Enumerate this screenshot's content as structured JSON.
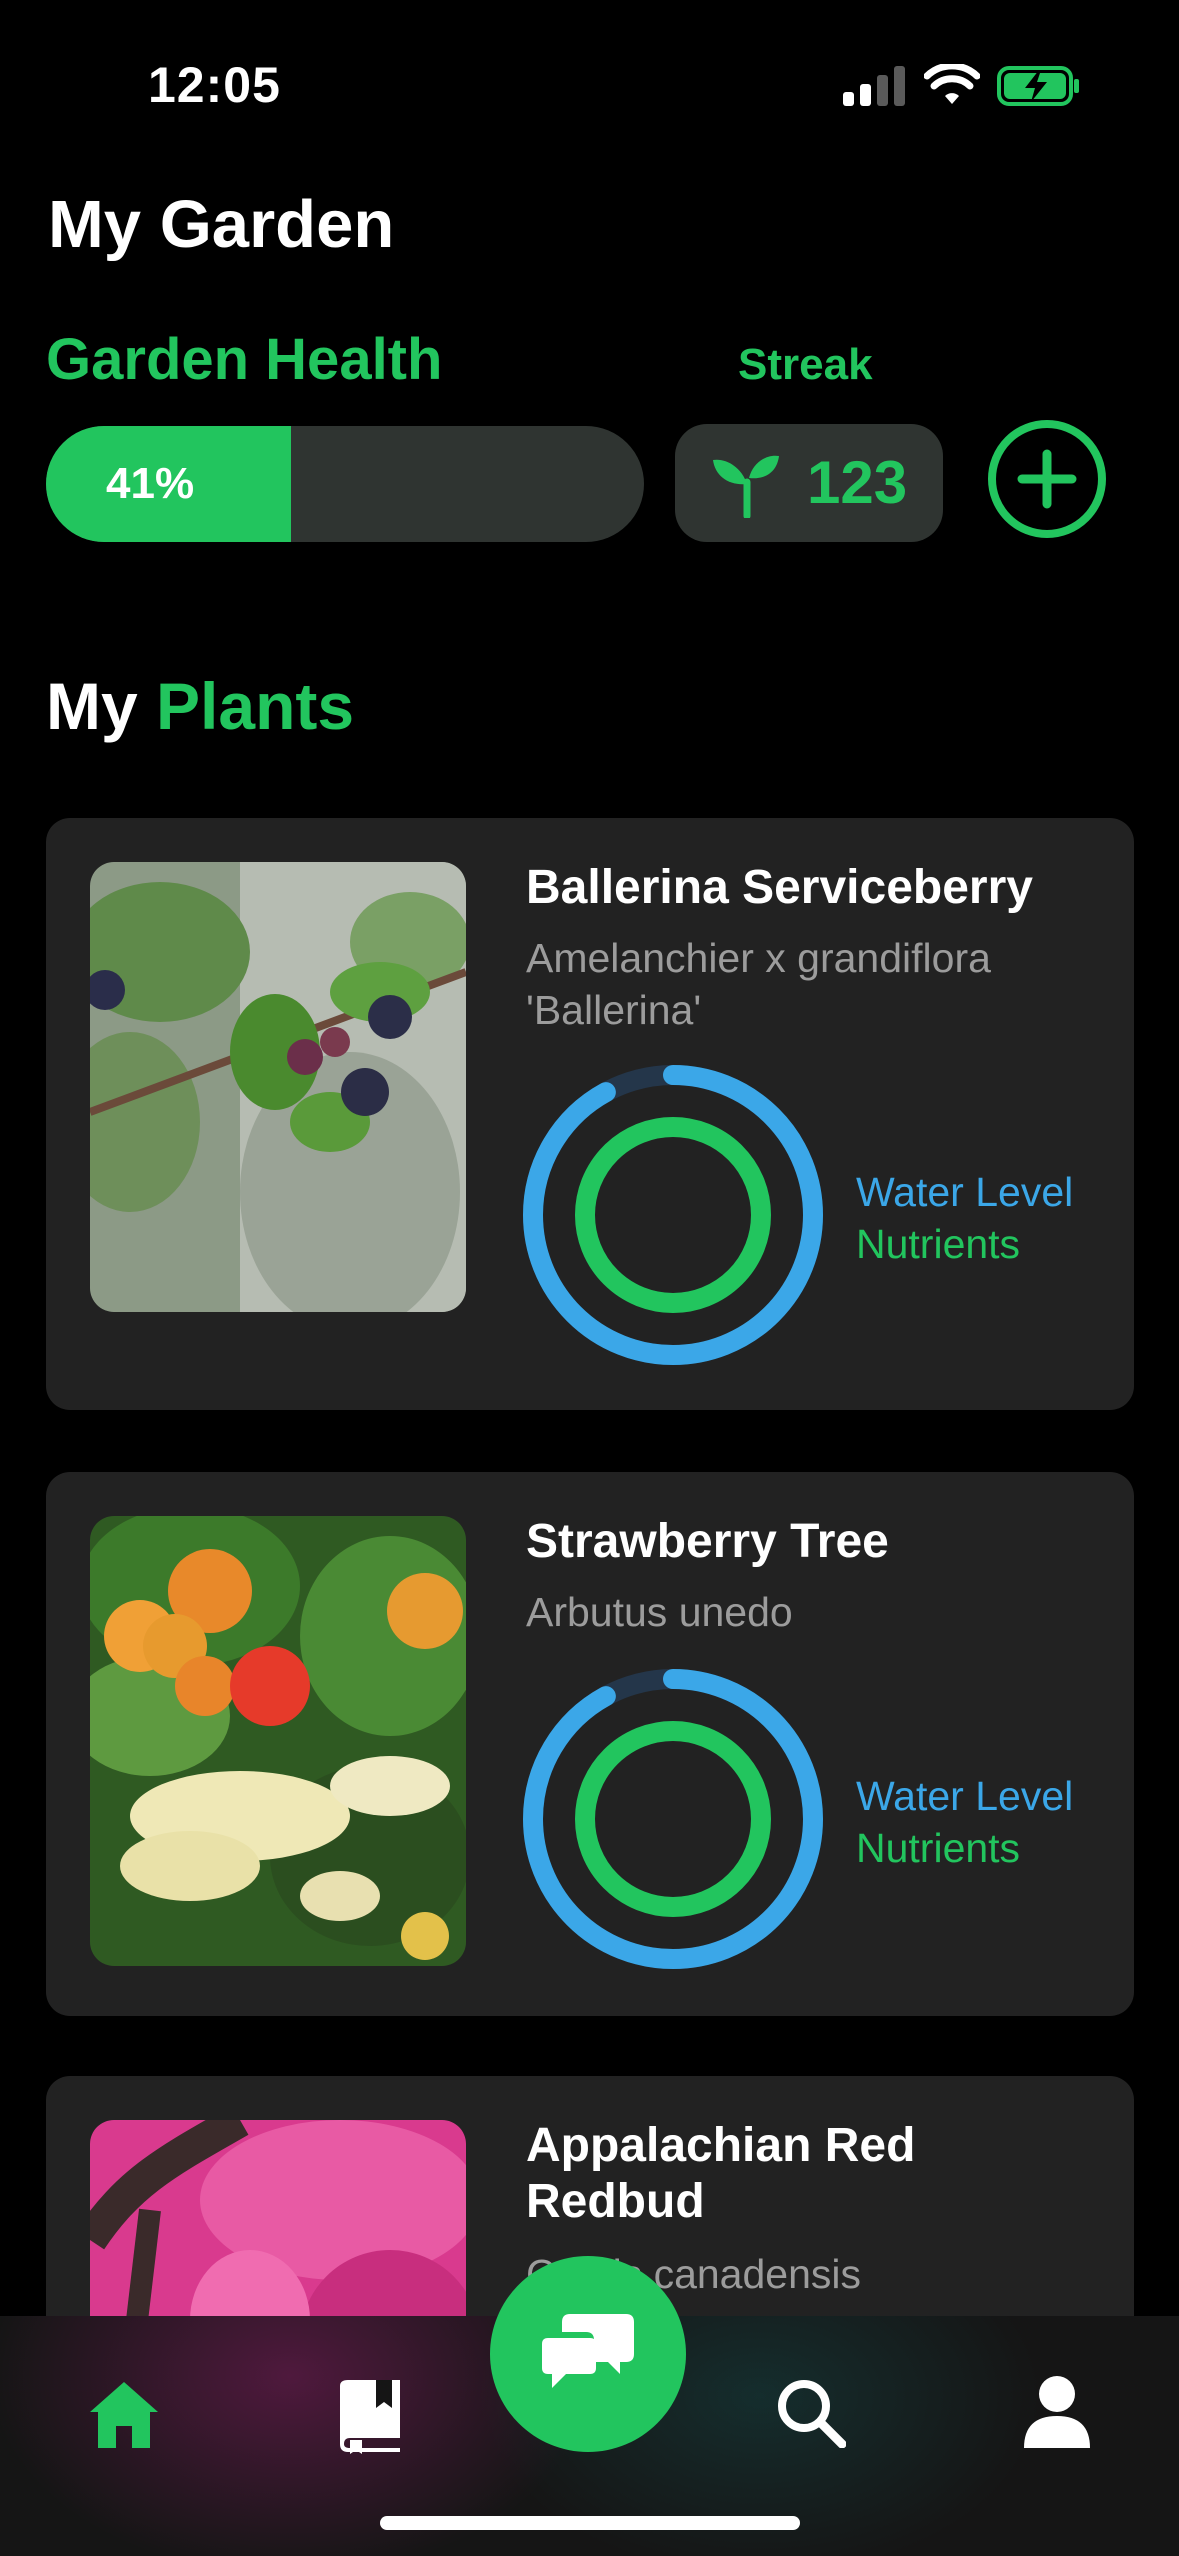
{
  "status_bar": {
    "time": "12:05",
    "battery_charging": true,
    "battery_color": "#22c55e"
  },
  "header": {
    "title": "My Garden"
  },
  "garden_health": {
    "label": "Garden Health",
    "value_text": "41%",
    "value": 0.41
  },
  "streak": {
    "label": "Streak",
    "value": "123",
    "icon": "sprout-icon"
  },
  "add_button": {
    "icon": "plus-icon"
  },
  "section": {
    "prefix": "My",
    "highlight": "Plants"
  },
  "plants": [
    {
      "name": "Ballerina Serviceberry",
      "scientific": "Amelanchier x grandiflora 'Ballerina'",
      "water_label": "Water Level",
      "nutrients_label": "Nutrients",
      "water_level": 0.92,
      "nutrients": 1.0
    },
    {
      "name": "Strawberry Tree",
      "scientific": "Arbutus unedo",
      "water_label": "Water Level",
      "nutrients_label": "Nutrients",
      "water_level": 0.92,
      "nutrients": 1.0
    },
    {
      "name": "Appalachian Red Redbud",
      "scientific": "Cercis canadensis"
    }
  ],
  "nav": {
    "items": [
      "home-icon",
      "book-icon",
      "chat-icon",
      "search-icon",
      "profile-icon"
    ],
    "active": "home-icon"
  },
  "colors": {
    "accent": "#22c55e",
    "water": "#3ba7e8",
    "card": "#222222"
  }
}
